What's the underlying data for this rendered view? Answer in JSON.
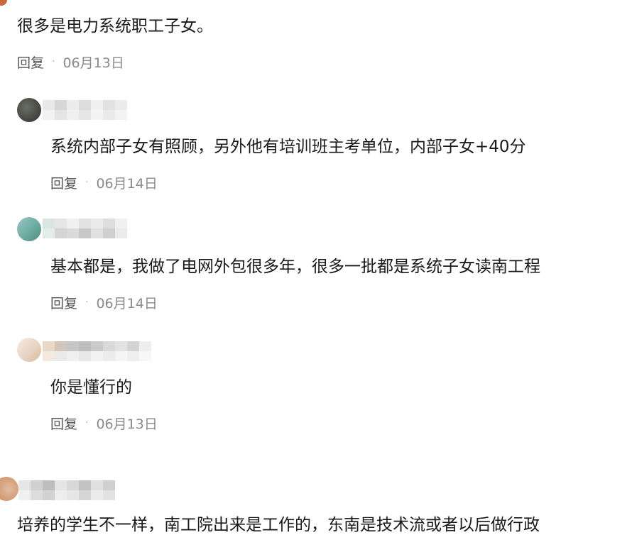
{
  "comments": [
    {
      "text": "很多是电力系统职工子女。",
      "reply_label": "回复",
      "separator": "·",
      "date": "06月13日"
    },
    {
      "text": "系统内部子女有照顾，另外他有培训班主考单位，内部子女+40分",
      "reply_label": "回复",
      "separator": "·",
      "date": "06月14日"
    },
    {
      "text": "基本都是，我做了电网外包很多年，很多一批都是系统子女读南工程",
      "reply_label": "回复",
      "separator": "·",
      "date": "06月14日"
    },
    {
      "text": "你是懂行的",
      "reply_label": "回复",
      "separator": "·",
      "date": "06月13日"
    },
    {
      "text": "培养的学生不一样，南工院出来是工作的，东南是技术流或者以后做行政"
    }
  ],
  "colors": {
    "text": "#1a1a1a",
    "meta": "#8a8a8a",
    "reply": "#555555"
  }
}
